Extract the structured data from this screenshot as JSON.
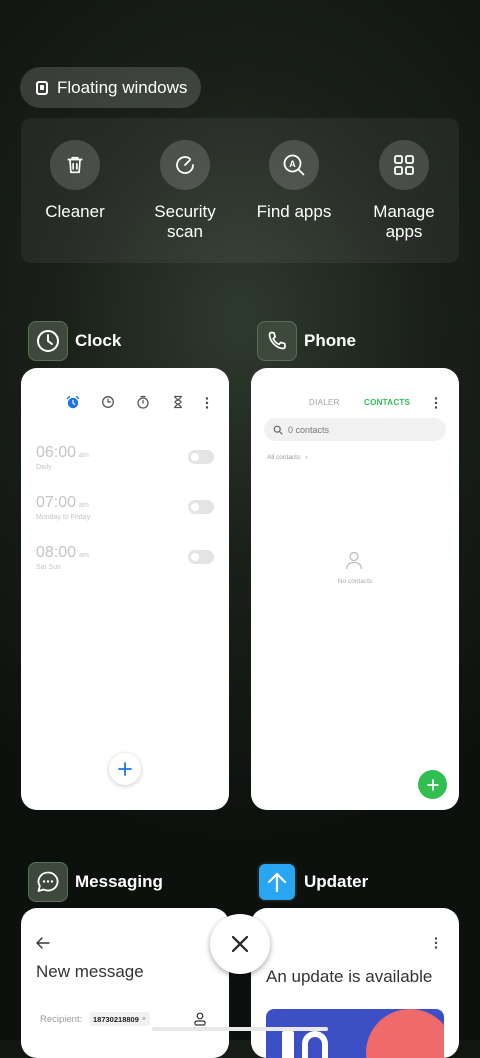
{
  "floating_windows": {
    "label": "Floating windows",
    "icon": "floating-window-icon"
  },
  "tools": [
    {
      "label": "Cleaner",
      "icon": "trash-icon"
    },
    {
      "label": "Security scan",
      "icon": "security-scan-icon"
    },
    {
      "label": "Find apps",
      "icon": "find-apps-icon"
    },
    {
      "label": "Manage apps",
      "icon": "grid-icon"
    }
  ],
  "apps": {
    "clock": {
      "name": "Clock",
      "alarms": [
        {
          "time": "06:00",
          "ampm": "am",
          "repeat": "Daily",
          "enabled": false
        },
        {
          "time": "07:00",
          "ampm": "am",
          "repeat": "Monday to Friday",
          "enabled": false
        },
        {
          "time": "08:00",
          "ampm": "am",
          "repeat": "Sat Sun",
          "enabled": false
        }
      ]
    },
    "phone": {
      "name": "Phone",
      "tabs": [
        "DIALER",
        "CONTACTS"
      ],
      "active_tab": "CONTACTS",
      "search_placeholder": "0 contacts",
      "filter_label": "All contacts",
      "empty_label": "No contacts"
    },
    "messaging": {
      "name": "Messaging",
      "title": "New message",
      "recipient_label": "Recipient:",
      "recipient_chip": "18730218809"
    },
    "updater": {
      "name": "Updater",
      "title": "An update is available"
    }
  },
  "colors": {
    "accent_blue": "#1a73e8",
    "accent_green": "#2fbe4f",
    "updater_blue": "#29a6f2"
  }
}
